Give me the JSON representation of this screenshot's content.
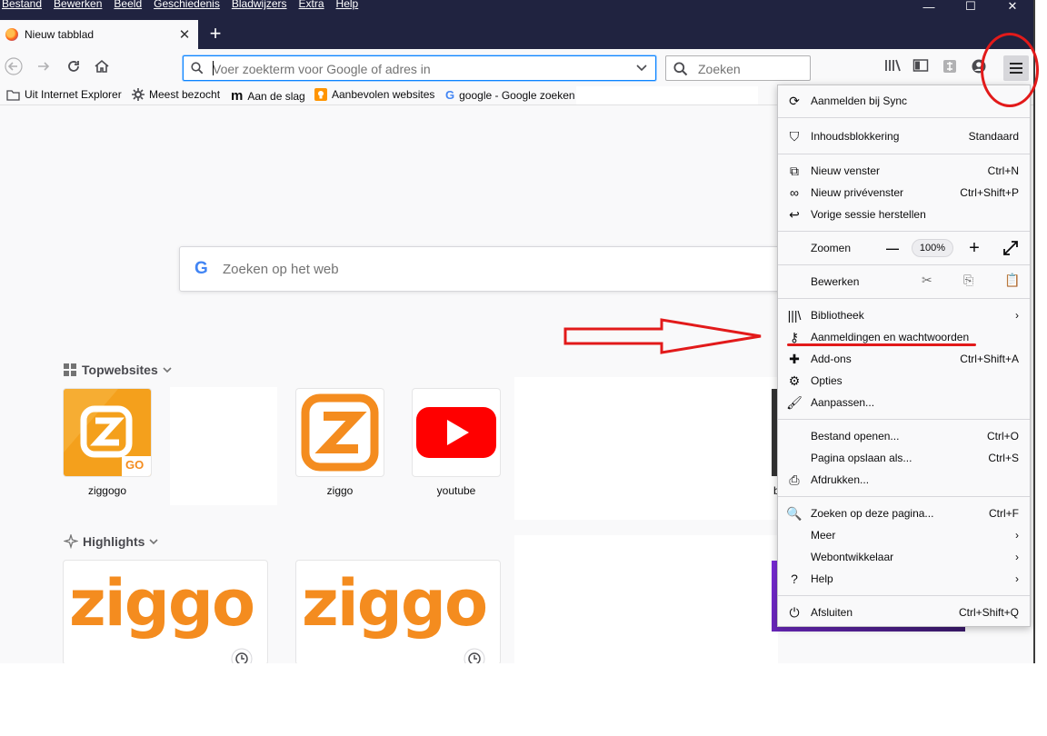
{
  "menubar": [
    "Bestand",
    "Bewerken",
    "Beeld",
    "Geschiedenis",
    "Bladwijzers",
    "Extra",
    "Help"
  ],
  "window_controls": {
    "minimize": "—",
    "maximize": "☐",
    "close": "✕"
  },
  "tab": {
    "label": "Nieuw tabblad",
    "close": "✕"
  },
  "newtab_label": "+",
  "urlbar": {
    "placeholder": "Voer zoekterm voor Google of adres in"
  },
  "searchbar": {
    "placeholder": "Zoeken"
  },
  "bookmarks": [
    "Uit Internet Explorer",
    "Meest bezocht",
    "Aan de slag",
    "Aanbevolen websites",
    "google - Google zoeken"
  ],
  "web_search": {
    "placeholder": "Zoeken op het web"
  },
  "topsites": {
    "heading": "Topwebsites",
    "tiles": [
      "ziggogo",
      "",
      "ziggo",
      "youtube"
    ]
  },
  "highlights": {
    "heading": "Highlights",
    "logo_text": "ziggo"
  },
  "ziggogo_badge": "GO",
  "colors": {
    "accent": "#0a84ff",
    "ziggo_orange": "#f48c1f",
    "youtube_red": "#ff0000",
    "annotation_red": "#e21a1a",
    "titlebar": "#202340"
  },
  "menu": {
    "sync": "Aanmelden bij Sync",
    "content_blocking": {
      "label": "Inhoudsblokkering",
      "value": "Standaard"
    },
    "new_window": {
      "label": "Nieuw venster",
      "shortcut": "Ctrl+N"
    },
    "private_window": {
      "label": "Nieuw privévenster",
      "shortcut": "Ctrl+Shift+P"
    },
    "restore_session": "Vorige sessie herstellen",
    "zoom": {
      "label": "Zoomen",
      "minus": "—",
      "value": "100%",
      "plus": "+"
    },
    "edit": "Bewerken",
    "library": "Bibliotheek",
    "logins": "Aanmeldingen en wachtwoorden",
    "addons": {
      "label": "Add-ons",
      "shortcut": "Ctrl+Shift+A"
    },
    "options": "Opties",
    "customize": "Aanpassen...",
    "open_file": {
      "label": "Bestand openen...",
      "shortcut": "Ctrl+O"
    },
    "save_page": {
      "label": "Pagina opslaan als...",
      "shortcut": "Ctrl+S"
    },
    "print": "Afdrukken...",
    "find": {
      "label": "Zoeken op deze pagina...",
      "shortcut": "Ctrl+F"
    },
    "more": "Meer",
    "webdev": "Webontwikkelaar",
    "help": "Help",
    "quit": {
      "label": "Afsluiten",
      "shortcut": "Ctrl+Shift+Q"
    }
  }
}
